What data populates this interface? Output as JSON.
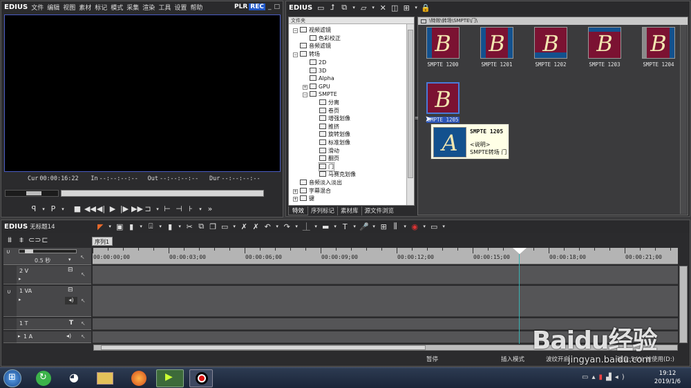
{
  "player": {
    "menubar": {
      "logo": "EDIUS",
      "items": [
        "文件",
        "编辑",
        "视图",
        "素材",
        "标记",
        "模式",
        "采集",
        "渲染",
        "工具",
        "设置",
        "帮助"
      ],
      "plr": "PLR",
      "rec": "REC"
    },
    "cur_label": "Cur",
    "cur_value": "00:00:16:22",
    "in_label": "In",
    "in_value": "--:--:--:--",
    "out_label": "Out",
    "out_value": "--:--:--:--",
    "dur_label": "Dur",
    "dur_value": "--:--:--:--"
  },
  "bin": {
    "menubar": {
      "logo": "EDIUS"
    },
    "folder_header": "文件夹",
    "path": "\\特效\\转场\\SMPTE\\门\\",
    "tree": [
      {
        "label": "视频滤镜",
        "exp": "−"
      },
      {
        "label": "色彩校正",
        "exp": ""
      },
      {
        "label": "音频滤镜",
        "exp": ""
      },
      {
        "label": "转场",
        "exp": "−"
      },
      {
        "label": "2D",
        "exp": ""
      },
      {
        "label": "3D",
        "exp": ""
      },
      {
        "label": "Alpha",
        "exp": ""
      },
      {
        "label": "GPU",
        "exp": "+"
      },
      {
        "label": "SMPTE",
        "exp": "−"
      },
      {
        "label": "分离",
        "exp": ""
      },
      {
        "label": "卷页",
        "exp": ""
      },
      {
        "label": "增强划像",
        "exp": ""
      },
      {
        "label": "推挤",
        "exp": ""
      },
      {
        "label": "旋转划像",
        "exp": ""
      },
      {
        "label": "标准划像",
        "exp": ""
      },
      {
        "label": "滑动",
        "exp": ""
      },
      {
        "label": "翻页",
        "exp": ""
      },
      {
        "label": "门",
        "exp": ""
      },
      {
        "label": "马赛克划像",
        "exp": ""
      },
      {
        "label": "音频淡入淡出",
        "exp": ""
      },
      {
        "label": "字幕混合",
        "exp": "+"
      },
      {
        "label": "键",
        "exp": "+"
      }
    ],
    "tabs": [
      "特效",
      "序列标记",
      "素材库",
      "源文件浏览"
    ],
    "thumbs": [
      {
        "label": "SMPTE 1200",
        "letter": "B"
      },
      {
        "label": "SMPTE 1201",
        "letter": "B"
      },
      {
        "label": "SMPTE 1202",
        "letter": "B"
      },
      {
        "label": "SMPTE 1203",
        "letter": "B"
      },
      {
        "label": "SMPTE 1204",
        "letter": "B"
      },
      {
        "label": "SMPTE 1205",
        "letter": "B"
      }
    ],
    "tooltip": {
      "title": "SMPTE 1205",
      "line1": "<说明>",
      "line2": "SMPTE转场 门",
      "letter": "A"
    }
  },
  "timeline": {
    "menubar": {
      "logo": "EDIUS",
      "project": "无标题14"
    },
    "seq_tab": "序列1",
    "zoom": "0.5 秒",
    "ruler": [
      "00:00:00;00",
      "00:00:03;00",
      "00:00:06;00",
      "00:00:09;00",
      "00:00:12;00",
      "00:00:15;00",
      "00:00:18;00",
      "00:00:21;00"
    ],
    "tracks": [
      {
        "name": "2 V"
      },
      {
        "name": "1 VA"
      },
      {
        "name": "1 T"
      },
      {
        "name": "1 A"
      }
    ],
    "status": {
      "pause": "暂停",
      "insert": "插入模式",
      "ripple": "波纹开启",
      "disk": "磁盘:54% 被使用(D:)"
    }
  },
  "taskbar": {
    "time": "19:12",
    "date": "2019/1/6"
  },
  "watermark": {
    "brand": "Baidu经验",
    "url": "jingyan.baidu.com"
  },
  "colors": {
    "accent": "#1f57c8",
    "thumb_red": "#7b1232",
    "thumb_blue": "#13518e",
    "playhead": "#38b2b2"
  }
}
